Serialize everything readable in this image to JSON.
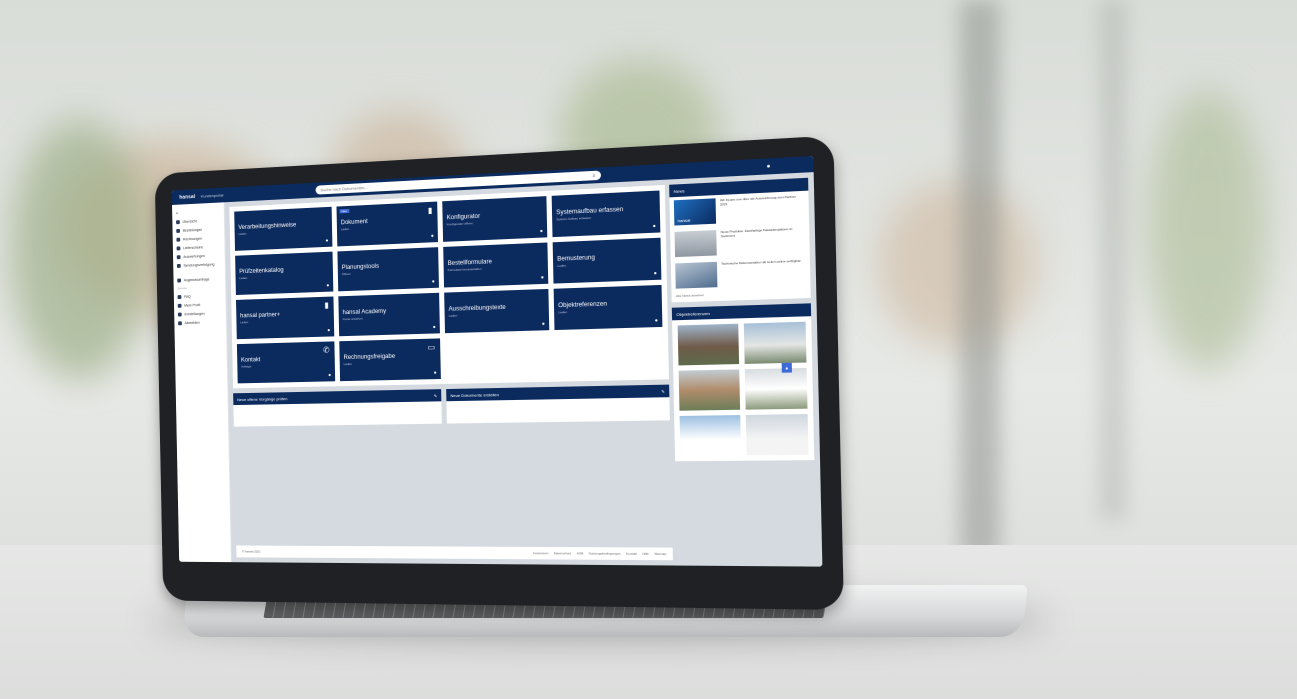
{
  "app": {
    "brand": "hansal",
    "brand_sub": "Kundenportal",
    "search_placeholder": "Suche nach Dokumenten..."
  },
  "sidebar": {
    "items": [
      {
        "label": "Übersicht"
      },
      {
        "label": "Bestellungen"
      },
      {
        "label": "Rechnungen"
      },
      {
        "label": "Lieferscheine"
      },
      {
        "label": "Auswertungen"
      },
      {
        "label": "Sendungsverfolgung"
      }
    ],
    "items2": [
      {
        "label": "Angebotsanfrage"
      }
    ],
    "section_label": "Service",
    "items3": [
      {
        "label": "FAQ"
      },
      {
        "label": "Mein Profil"
      },
      {
        "label": "Einstellungen"
      },
      {
        "label": "Abmelden"
      }
    ]
  },
  "tiles": [
    {
      "title": "Verarbeitungshinweise",
      "sub": "Laden",
      "badge": ""
    },
    {
      "title": "Dokument",
      "sub": "Laden",
      "badge": "Neu"
    },
    {
      "title": "Konfigurator",
      "sub": "Konfigurator öffnen",
      "badge": ""
    },
    {
      "title": "Systemaufbau erfassen",
      "sub": "System-Aufbau erfassen",
      "badge": ""
    },
    {
      "title": "Prüfzeitenkatalog",
      "sub": "Laden",
      "badge": ""
    },
    {
      "title": "Planungstools",
      "sub": "Öffnen",
      "badge": ""
    },
    {
      "title": "Bestellformulare",
      "sub": "Formulare herunterladen",
      "badge": ""
    },
    {
      "title": "Bemusterung",
      "sub": "Laden",
      "badge": ""
    },
    {
      "title": "hansal partner+",
      "sub": "Laden",
      "badge": ""
    },
    {
      "title": "hansal Academy",
      "sub": "Kurse ansehen",
      "badge": ""
    },
    {
      "title": "Ausschreibungstexte",
      "sub": "Laden",
      "badge": ""
    },
    {
      "title": "Objektreferenzen",
      "sub": "Laden",
      "badge": ""
    },
    {
      "title": "Kontakt",
      "sub": "Anfrage",
      "badge": ""
    },
    {
      "title": "Rechnungsfreigabe",
      "sub": "Laden",
      "badge": ""
    }
  ],
  "widgets": {
    "left_title": "Neue offene Vorgänge prüfen",
    "right_title": "Neue Dokumente erstellen"
  },
  "footer": {
    "copyright": "© hansal 2021",
    "links": [
      "Impressum",
      "Datenschutz",
      "AGB",
      "Nutzungsbedingungen",
      "Kontakt",
      "Hilfe",
      "Sitemap"
    ]
  },
  "news": {
    "title": "News",
    "items": [
      {
        "text": "Wir freuen uns über die Auszeichnung zum Partner 2021"
      },
      {
        "text": "Neue Produkte: Zweifarbige Fassadenplatten im Sortiment"
      },
      {
        "text": "Technische Dokumentation ab sofort online verfügbar"
      }
    ],
    "more": "Alle News ansehen"
  },
  "references": {
    "title": "Objektreferenzen"
  }
}
